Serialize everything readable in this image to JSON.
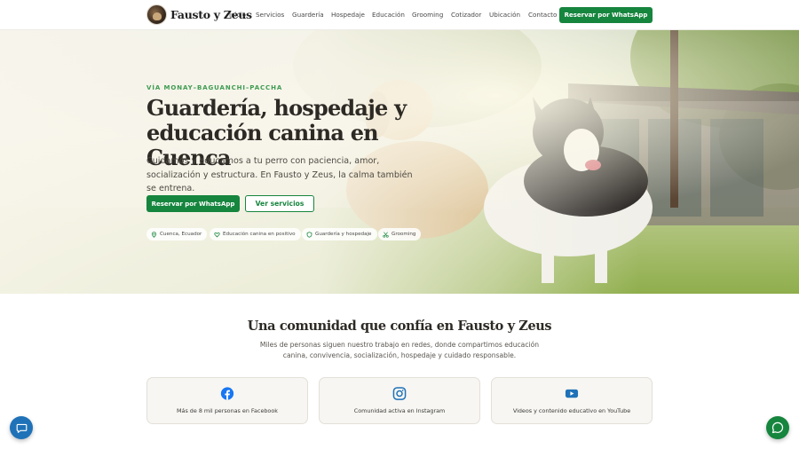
{
  "nav": {
    "brand": "Fausto y Zeus",
    "links": [
      {
        "label": "Inicio",
        "id": "inicio"
      },
      {
        "label": "Servicios",
        "id": "servicios"
      },
      {
        "label": "Guardería",
        "id": "guarderia"
      },
      {
        "label": "Hospedaje",
        "id": "hospedaje"
      },
      {
        "label": "Educación",
        "id": "educacion"
      },
      {
        "label": "Grooming",
        "id": "grooming"
      },
      {
        "label": "Cotizador",
        "id": "cotizador"
      },
      {
        "label": "Ubicación",
        "id": "ubicacion"
      },
      {
        "label": "Contacto",
        "id": "contacto"
      }
    ],
    "cta": "Reservar por WhatsApp"
  },
  "hero": {
    "eyebrow": "VÍA MONAY–BAGUANCHI–PACCHA",
    "title": "Guardería, hospedaje y educación canina en Cuenca",
    "lead": "Cuidamos y educamos a tu perro con paciencia, amor, socialización y estructura. En Fausto y Zeus, la calma también se entrena.",
    "primary_cta": "Reservar por WhatsApp",
    "secondary_cta": "Ver servicios",
    "chips": [
      {
        "label": "Cuenca, Ecuador",
        "icon": "map-pin-icon"
      },
      {
        "label": "Educación canina en positivo",
        "icon": "heart-icon"
      },
      {
        "label": "Guardería y hospedaje",
        "icon": "shield-icon"
      },
      {
        "label": "Grooming",
        "icon": "scissors-icon"
      }
    ]
  },
  "community": {
    "title": "Una comunidad que confía en Fausto y Zeus",
    "subtitle": "Miles de personas siguen nuestro trabajo en redes, donde compartimos educación canina, convivencia, socialización, hospedaje y cuidado responsable.",
    "cards": [
      {
        "label": "Más de 8 mil personas en Facebook",
        "icon": "facebook-icon"
      },
      {
        "label": "Comunidad activa en Instagram",
        "icon": "instagram-icon"
      },
      {
        "label": "Videos y contenido educativo en YouTube",
        "icon": "youtube-icon"
      }
    ]
  },
  "colors": {
    "accent": "#16853e",
    "eyebrow": "#3e9b52",
    "chat_button": "#1f72b8",
    "facebook": "#1877f2",
    "instagram": "#1f72b8",
    "youtube": "#1f72b8"
  }
}
